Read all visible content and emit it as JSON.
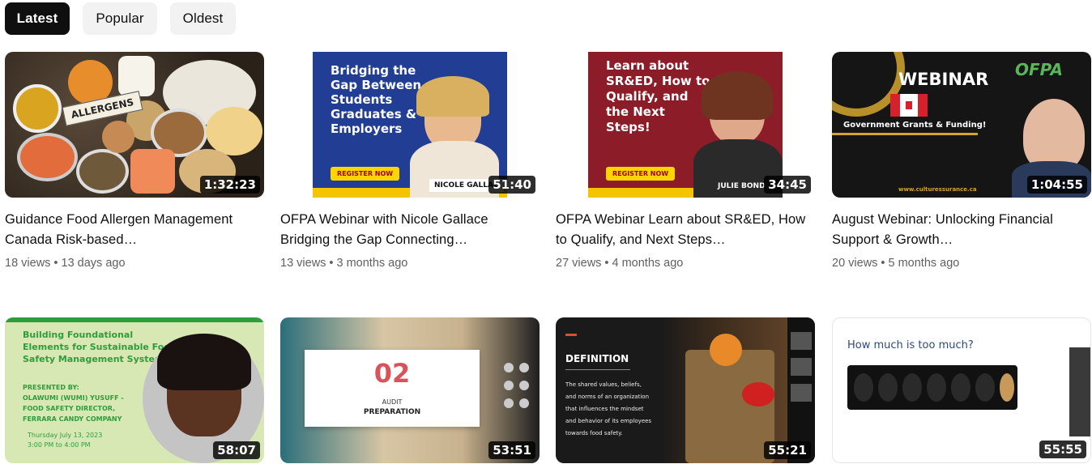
{
  "filters": {
    "chips": [
      {
        "label": "Latest",
        "active": true
      },
      {
        "label": "Popular",
        "active": false
      },
      {
        "label": "Oldest",
        "active": false
      }
    ]
  },
  "videos": [
    {
      "title": "Guidance Food Allergen Management Canada Risk-based…",
      "duration": "1:32:23",
      "views": "18 views",
      "age": "13 days ago",
      "thumb_text": [
        "ALLERGENS"
      ]
    },
    {
      "title": "OFPA Webinar with Nicole Gallace Bridging the Gap Connecting…",
      "duration": "51:40",
      "views": "13 views",
      "age": "3 months ago",
      "thumb_text": [
        "Bridging the",
        "Gap Between",
        "Students",
        "Graduates &",
        "Employers",
        "REGISTER NOW",
        "NICOLE GALLAC"
      ]
    },
    {
      "title": "OFPA Webinar Learn about SR&ED, How to Qualify, and Next Steps…",
      "duration": "34:45",
      "views": "27 views",
      "age": "4 months ago",
      "thumb_text": [
        "Learn about",
        "SR&ED, How to",
        "Qualify, and",
        "the Next",
        "Steps!",
        "REGISTER NOW",
        "JULIE BOND"
      ]
    },
    {
      "title": "August Webinar: Unlocking Financial Support & Growth…",
      "duration": "1:04:55",
      "views": "20 views",
      "age": "5 months ago",
      "thumb_text": [
        "WEBINAR",
        "Government Grants & Funding!",
        "OFPA",
        "www.culturessurance.ca"
      ]
    },
    {
      "title": "",
      "duration": "58:07",
      "views": "",
      "age": "",
      "thumb_text": [
        "Building Foundational",
        "Elements for Sustainable Food",
        "Safety Management System",
        "PRESENTED BY:",
        "OLAWUMI (WUMI) YUSUFF -",
        "FOOD SAFETY DIRECTOR,",
        "FERRARA CANDY COMPANY",
        "Thursday July 13, 2023",
        "3:00 PM to 4:00 PM"
      ]
    },
    {
      "title": "",
      "duration": "53:51",
      "views": "",
      "age": "",
      "thumb_text": [
        "02",
        "AUDIT",
        "PREPARATION"
      ]
    },
    {
      "title": "",
      "duration": "55:21",
      "views": "",
      "age": "",
      "thumb_text": [
        "DEFINITION",
        "The shared values, beliefs,",
        "and norms of an organization",
        "that influences the mindset",
        "and behavior of its employees",
        "towards food safety."
      ]
    },
    {
      "title": "",
      "duration": "55:55",
      "views": "",
      "age": "",
      "thumb_text": [
        "How much is too much?"
      ]
    }
  ],
  "colors": {
    "chip_active_bg": "#0f0f0f",
    "chip_bg": "#f2f2f2",
    "meta_text": "#606060"
  }
}
